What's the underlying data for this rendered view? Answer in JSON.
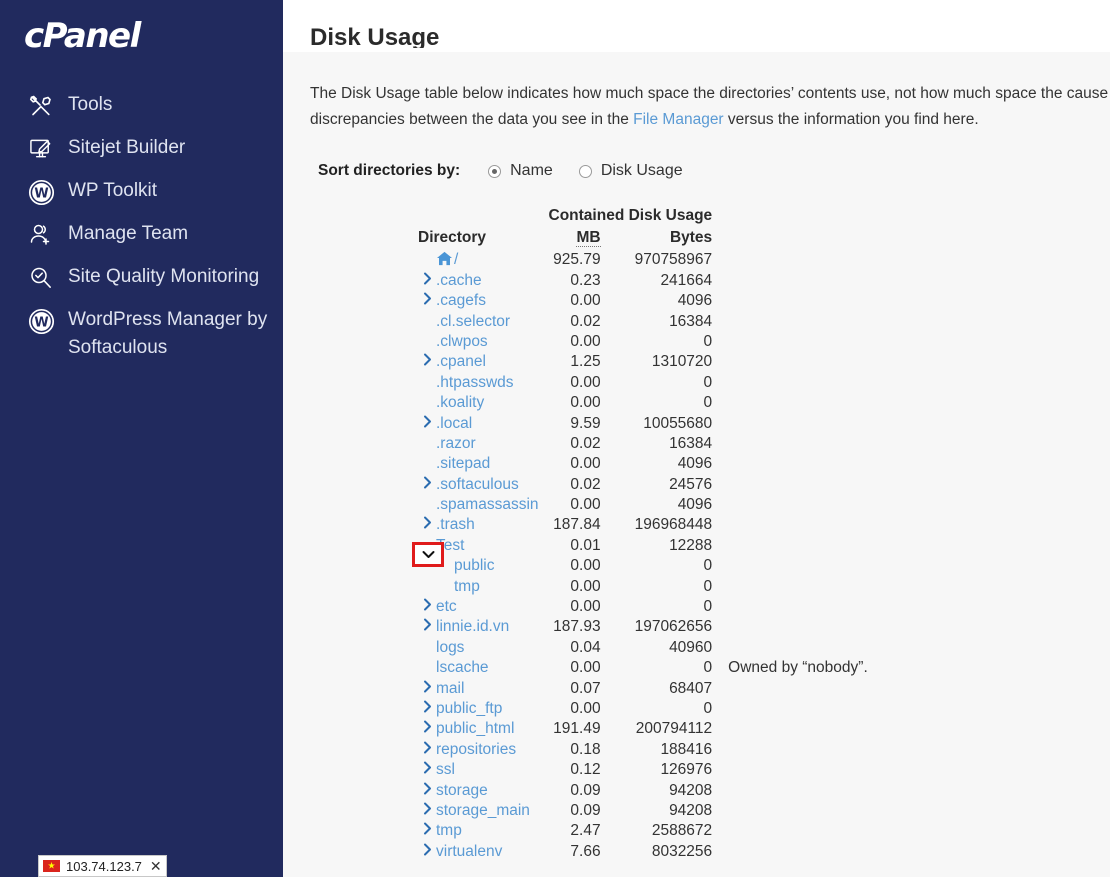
{
  "brand": {
    "name": "cPanel"
  },
  "sidebar": {
    "items": [
      {
        "label": "Tools",
        "icon": "tools-icon"
      },
      {
        "label": "Sitejet Builder",
        "icon": "sitejet-builder-icon"
      },
      {
        "label": "WP Toolkit",
        "icon": "wordpress-icon"
      },
      {
        "label": "Manage Team",
        "icon": "manage-team-icon"
      },
      {
        "label": "Site Quality Monitoring",
        "icon": "site-quality-monitoring-icon"
      },
      {
        "label": "WordPress Manager by Softaculous",
        "icon": "wordpress-icon"
      }
    ],
    "ip_badge": {
      "ip": "103.74.123.7",
      "close_label": "✕",
      "flag": "vietnam-flag-icon"
    }
  },
  "page": {
    "heading": "Disk Usage",
    "intro_part1": "The Disk Usage table below indicates how much space the directories’ contents use, not how much space the ",
    "intro_part2": "cause discrepancies between the data you see in the ",
    "intro_link": "File Manager",
    "intro_part3": " versus the information you find here."
  },
  "sort": {
    "label": "Sort directories by:",
    "options": [
      {
        "label": "Name",
        "checked": true
      },
      {
        "label": "Disk Usage",
        "checked": false
      }
    ]
  },
  "table": {
    "headers": {
      "directory": "Directory",
      "group": "Contained Disk Usage",
      "mb": "MB",
      "bytes": "Bytes"
    },
    "rows": [
      {
        "name": "/",
        "mb": "925.79",
        "bytes": "970758967",
        "toggle": "home",
        "indent": 0,
        "note": ""
      },
      {
        "name": ".cache",
        "mb": "0.23",
        "bytes": "241664",
        "toggle": "right",
        "indent": 0,
        "note": ""
      },
      {
        "name": ".cagefs",
        "mb": "0.00",
        "bytes": "4096",
        "toggle": "right",
        "indent": 0,
        "note": ""
      },
      {
        "name": ".cl.selector",
        "mb": "0.02",
        "bytes": "16384",
        "toggle": "none",
        "indent": 0,
        "note": ""
      },
      {
        "name": ".clwpos",
        "mb": "0.00",
        "bytes": "0",
        "toggle": "none",
        "indent": 0,
        "note": ""
      },
      {
        "name": ".cpanel",
        "mb": "1.25",
        "bytes": "1310720",
        "toggle": "right",
        "indent": 0,
        "note": ""
      },
      {
        "name": ".htpasswds",
        "mb": "0.00",
        "bytes": "0",
        "toggle": "none",
        "indent": 0,
        "note": ""
      },
      {
        "name": ".koality",
        "mb": "0.00",
        "bytes": "0",
        "toggle": "none",
        "indent": 0,
        "note": ""
      },
      {
        "name": ".local",
        "mb": "9.59",
        "bytes": "10055680",
        "toggle": "right",
        "indent": 0,
        "note": ""
      },
      {
        "name": ".razor",
        "mb": "0.02",
        "bytes": "16384",
        "toggle": "none",
        "indent": 0,
        "note": ""
      },
      {
        "name": ".sitepad",
        "mb": "0.00",
        "bytes": "4096",
        "toggle": "none",
        "indent": 0,
        "note": ""
      },
      {
        "name": ".softaculous",
        "mb": "0.02",
        "bytes": "24576",
        "toggle": "right",
        "indent": 0,
        "note": ""
      },
      {
        "name": ".spamassassin",
        "mb": "0.00",
        "bytes": "4096",
        "toggle": "none",
        "indent": 0,
        "note": ""
      },
      {
        "name": ".trash",
        "mb": "187.84",
        "bytes": "196968448",
        "toggle": "right",
        "indent": 0,
        "note": ""
      },
      {
        "name": "Test",
        "mb": "0.01",
        "bytes": "12288",
        "toggle": "down-highlighted",
        "indent": 0,
        "note": ""
      },
      {
        "name": "public",
        "mb": "0.00",
        "bytes": "0",
        "toggle": "none",
        "indent": 1,
        "note": ""
      },
      {
        "name": "tmp",
        "mb": "0.00",
        "bytes": "0",
        "toggle": "none",
        "indent": 1,
        "note": ""
      },
      {
        "name": "etc",
        "mb": "0.00",
        "bytes": "0",
        "toggle": "right",
        "indent": 0,
        "note": ""
      },
      {
        "name": "linnie.id.vn",
        "mb": "187.93",
        "bytes": "197062656",
        "toggle": "right",
        "indent": 0,
        "note": ""
      },
      {
        "name": "logs",
        "mb": "0.04",
        "bytes": "40960",
        "toggle": "none",
        "indent": 0,
        "note": ""
      },
      {
        "name": "lscache",
        "mb": "0.00",
        "bytes": "0",
        "toggle": "none",
        "indent": 0,
        "note": "Owned by “nobody”."
      },
      {
        "name": "mail",
        "mb": "0.07",
        "bytes": "68407",
        "toggle": "right",
        "indent": 0,
        "note": ""
      },
      {
        "name": "public_ftp",
        "mb": "0.00",
        "bytes": "0",
        "toggle": "right",
        "indent": 0,
        "note": ""
      },
      {
        "name": "public_html",
        "mb": "191.49",
        "bytes": "200794112",
        "toggle": "right",
        "indent": 0,
        "note": ""
      },
      {
        "name": "repositories",
        "mb": "0.18",
        "bytes": "188416",
        "toggle": "right",
        "indent": 0,
        "note": ""
      },
      {
        "name": "ssl",
        "mb": "0.12",
        "bytes": "126976",
        "toggle": "right",
        "indent": 0,
        "note": ""
      },
      {
        "name": "storage",
        "mb": "0.09",
        "bytes": "94208",
        "toggle": "right",
        "indent": 0,
        "note": ""
      },
      {
        "name": "storage_main",
        "mb": "0.09",
        "bytes": "94208",
        "toggle": "right",
        "indent": 0,
        "note": ""
      },
      {
        "name": "tmp",
        "mb": "2.47",
        "bytes": "2588672",
        "toggle": "right",
        "indent": 0,
        "note": ""
      },
      {
        "name": "virtualenv",
        "mb": "7.66",
        "bytes": "8032256",
        "toggle": "right",
        "indent": 0,
        "note": ""
      }
    ]
  },
  "colors": {
    "sidebar_bg": "#212a5e",
    "link": "#5a9ad4",
    "content_bg": "#f7f7f7",
    "highlight": "#e01b1b"
  }
}
